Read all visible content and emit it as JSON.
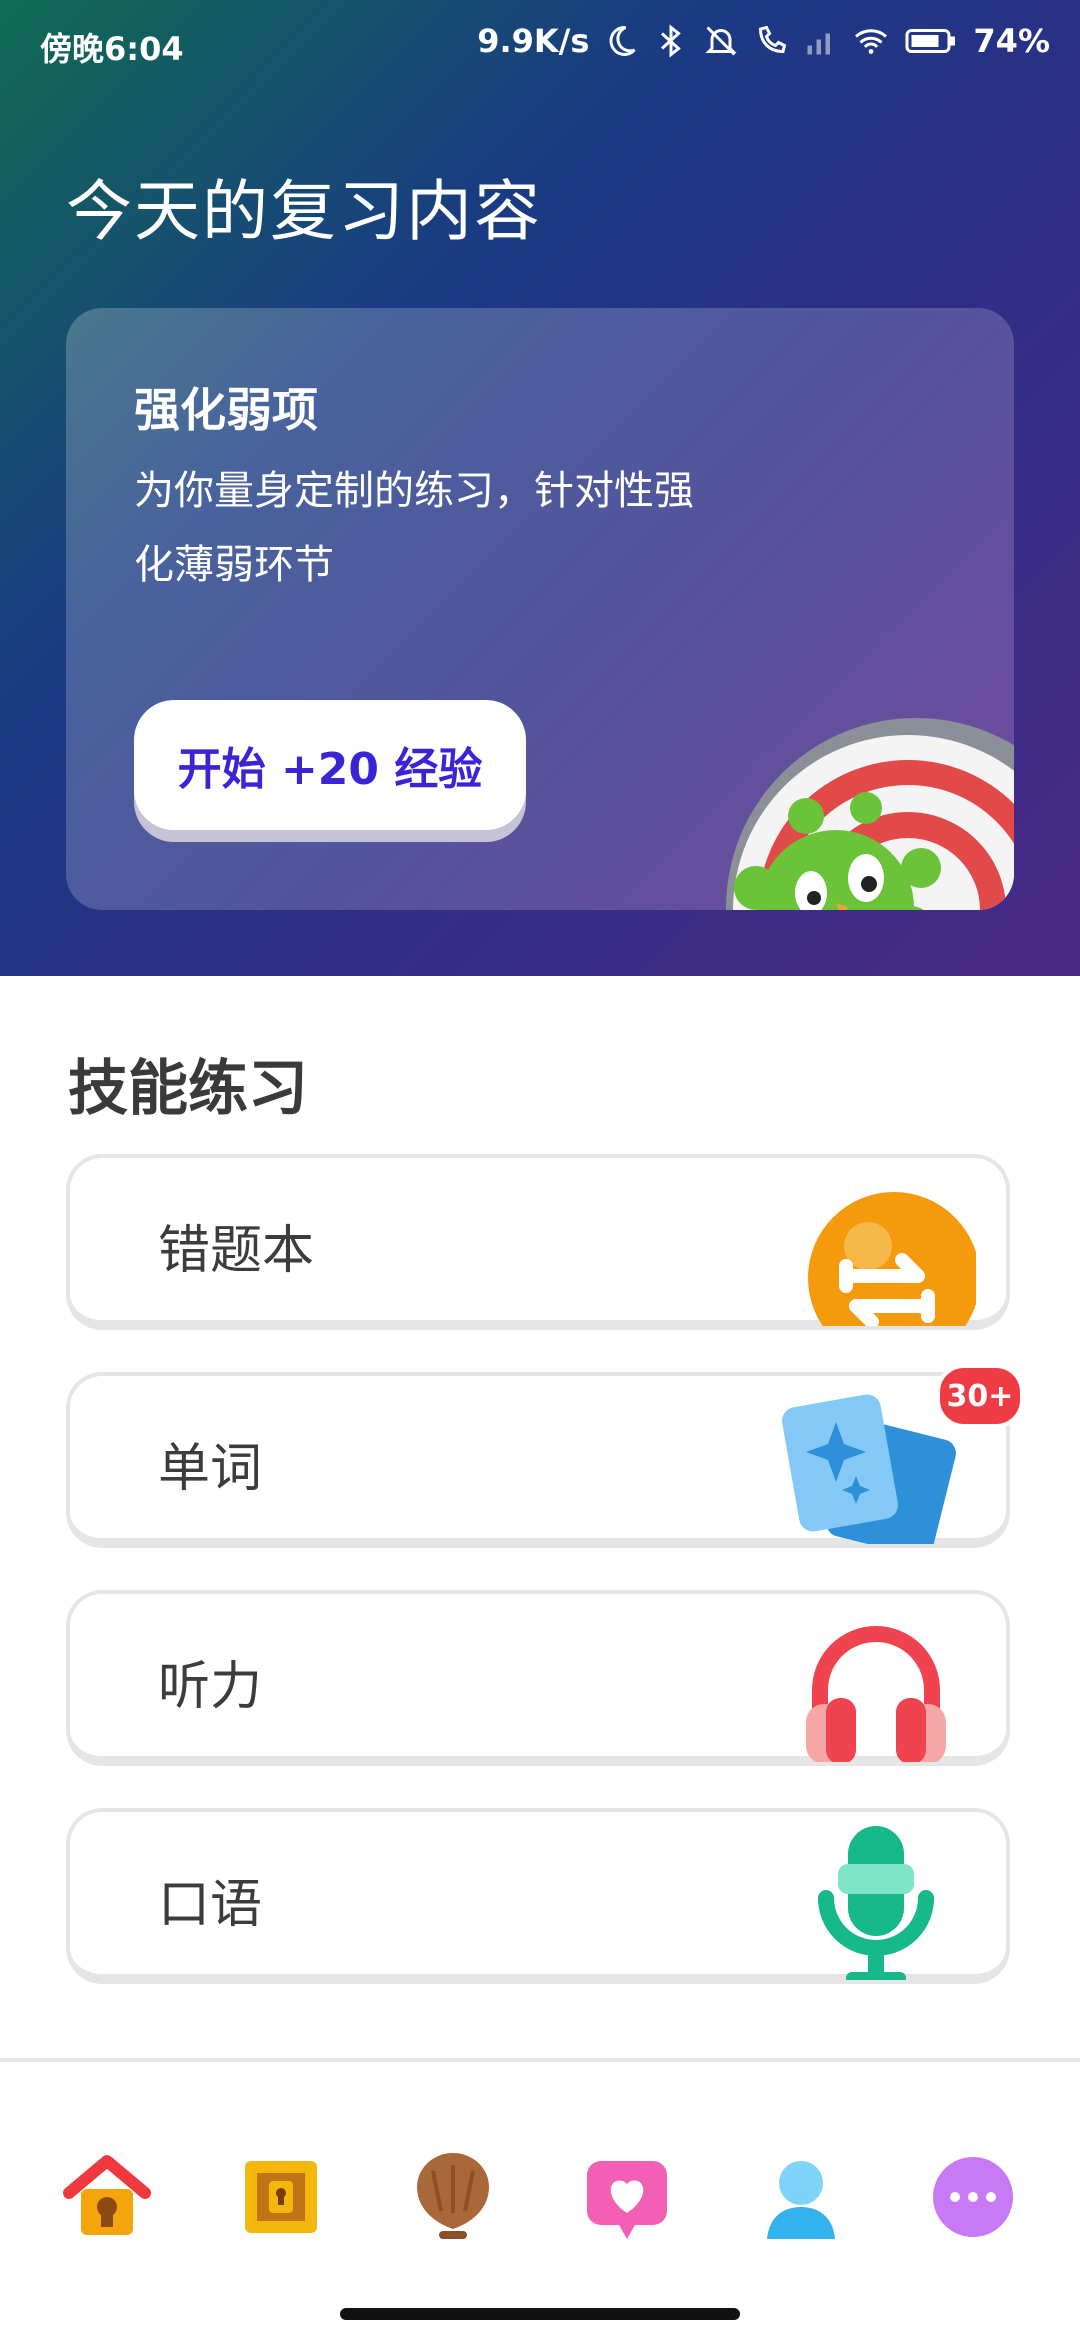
{
  "status_bar": {
    "time": "傍晚6:04",
    "net_speed": "9.9K/s",
    "battery": "74%"
  },
  "hero": {
    "title": "今天的复习内容",
    "card": {
      "title": "强化弱项",
      "description": "为你量身定制的练习，针对性强化薄弱环节",
      "button_label": "开始 +20 经验"
    }
  },
  "skills": {
    "title": "技能练习",
    "items": [
      {
        "label": "错题本",
        "icon": "swap-arrows-icon"
      },
      {
        "label": "单词",
        "icon": "word-cards-icon",
        "badge": "30+"
      },
      {
        "label": "听力",
        "icon": "headphones-icon"
      },
      {
        "label": "口语",
        "icon": "microphone-icon"
      }
    ]
  },
  "bottom_nav": {
    "items": [
      "home-icon",
      "treasure-chest-icon",
      "league-shell-icon",
      "heart-chat-icon",
      "profile-icon",
      "more-icon"
    ]
  },
  "colors": {
    "accent_button_text": "#3a24d6",
    "badge": "#ef3b44",
    "gradient_start": "#106b53",
    "gradient_end": "#4a2a86"
  }
}
